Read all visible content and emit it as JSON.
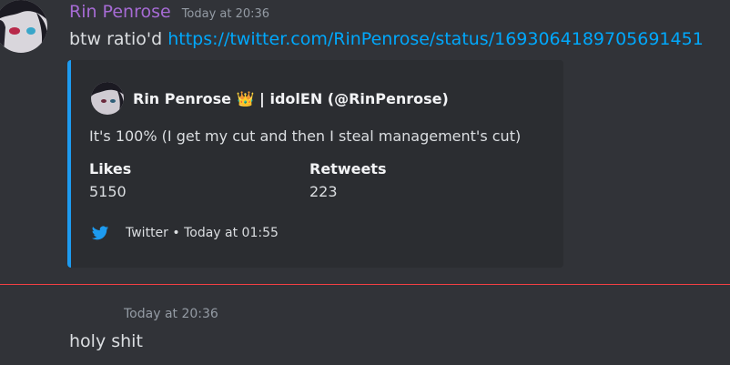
{
  "message": {
    "username": "Rin Penrose",
    "timestamp": "Today at 20:36",
    "text": "btw ratio'd",
    "link": "https://twitter.com/RinPenrose/status/1693064189705691451",
    "colors": {
      "username": "#a66bd4",
      "link": "#00a8fc"
    }
  },
  "embed": {
    "author": "Rin Penrose 👑 | idolEN (@RinPenrose)",
    "description": "It's 100% (I get my cut and then I steal management's cut)",
    "fields": [
      {
        "name": "Likes",
        "value": "5150"
      },
      {
        "name": "Retweets",
        "value": "223"
      }
    ],
    "footer": "Twitter • Today at 01:55",
    "footer_icon": "twitter-bird-icon",
    "accent_color": "#1d9bf0"
  },
  "followup": {
    "timestamp": "Today at 20:36",
    "text": "holy shit"
  },
  "divider_color": "#f23f43"
}
